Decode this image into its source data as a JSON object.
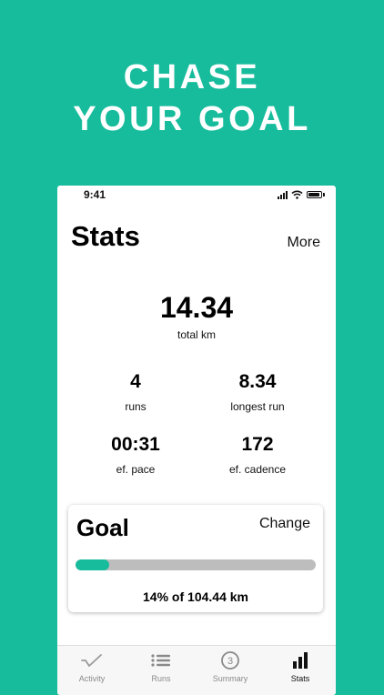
{
  "headline": {
    "line1": "CHASE",
    "line2": "YOUR GOAL"
  },
  "status_bar": {
    "time": "9:41"
  },
  "stats": {
    "title": "Stats",
    "more_label": "More",
    "total": {
      "value": "14.34",
      "label": "total km"
    },
    "items": [
      {
        "value": "4",
        "label": "runs"
      },
      {
        "value": "8.34",
        "label": "longest run"
      },
      {
        "value": "00:31",
        "label": "ef. pace"
      },
      {
        "value": "172",
        "label": "ef. cadence"
      }
    ]
  },
  "goal": {
    "title": "Goal",
    "change_label": "Change",
    "progress_fraction": 0.14,
    "progress_text": "14% of 104.44 km"
  },
  "tabs": [
    {
      "label": "Activity",
      "icon": "activity-check-icon"
    },
    {
      "label": "Runs",
      "icon": "list-icon"
    },
    {
      "label": "Summary",
      "icon": "summary-circle-icon",
      "badge": "3"
    },
    {
      "label": "Stats",
      "icon": "bar-chart-icon",
      "active": true
    }
  ],
  "colors": {
    "accent": "#17BC9C",
    "progress_track": "#BDBDBD"
  }
}
